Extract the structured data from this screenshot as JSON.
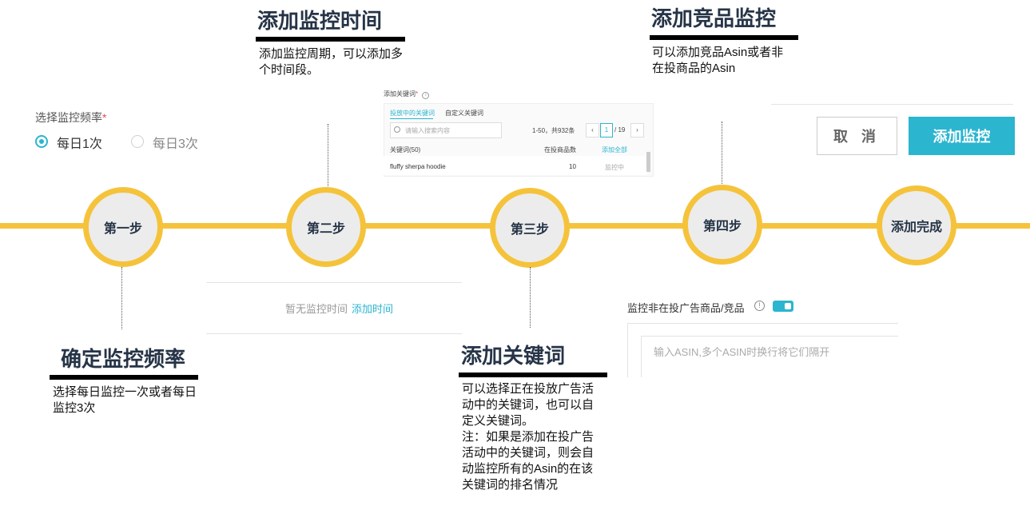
{
  "steps": {
    "s1": "第一步",
    "s2": "第二步",
    "s3": "第三步",
    "s4": "第四步",
    "s5": "添加完成"
  },
  "captions": {
    "c1": {
      "title": "确定监控频率",
      "text": "选择每日监控一次或者每日监控3次"
    },
    "c2": {
      "title": "添加监控时间",
      "text": "添加监控周期，可以添加多个时间段。"
    },
    "c3": {
      "title": "添加关键词",
      "text": "可以选择正在投放广告活动中的关键词，也可以自定义关键词。\n注：如果是添加在投广告活动中的关键词，则会自动监控所有的Asin的在该关键词的排名情况"
    },
    "c4": {
      "title": "添加竞品监控",
      "text": "可以添加竞品Asin或者非在投商品的Asin"
    }
  },
  "freq_widget": {
    "label": "选择监控频率",
    "required_mark": "*",
    "options": [
      "每日1次",
      "每日3次"
    ],
    "selected": "每日1次"
  },
  "time_widget": {
    "empty_text": "暂无监控时间",
    "add_link": "添加时间"
  },
  "keyword_widget": {
    "label": "添加关键词",
    "required_mark": "*",
    "tabs": [
      "投放中的关键词",
      "自定义关键词"
    ],
    "search_placeholder": "请输入搜索内容",
    "range": "1-50，共932条",
    "page_current": "1",
    "page_total": "/ 19",
    "col_keyword": "关键词(50)",
    "col_count": "在投商品数",
    "add_all": "添加全部",
    "row": {
      "keyword": "fluffy sherpa hoodie",
      "count": "10",
      "status": "监控中"
    }
  },
  "competitor_widget": {
    "label": "监控非在投广告商品/竞品",
    "placeholder": "输入ASIN,多个ASIN时换行将它们隔开",
    "toggle_on": true
  },
  "actions": {
    "cancel": "取 消",
    "confirm": "添加监控"
  }
}
